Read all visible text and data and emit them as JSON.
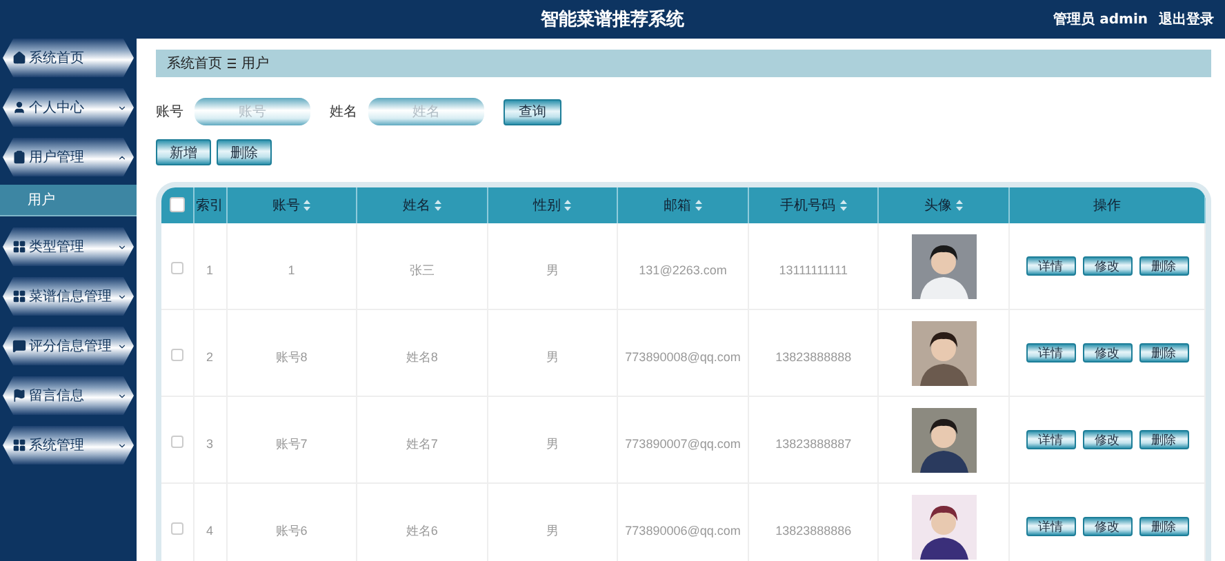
{
  "header": {
    "title": "智能菜谱推荐系统",
    "user": "管理员 admin",
    "logout": "退出登录"
  },
  "sidebar": {
    "items": [
      {
        "label": "系统首页",
        "kind": "link"
      },
      {
        "label": "个人中心",
        "kind": "menu",
        "expanded": false
      },
      {
        "label": "用户管理",
        "kind": "menu",
        "expanded": true,
        "children": [
          {
            "label": "用户",
            "selected": true
          }
        ]
      },
      {
        "label": "类型管理",
        "kind": "menu",
        "expanded": false
      },
      {
        "label": "菜谱信息管理",
        "kind": "menu",
        "expanded": false
      },
      {
        "label": "评分信息管理",
        "kind": "menu",
        "expanded": false
      },
      {
        "label": "留言信息",
        "kind": "menu",
        "expanded": false
      },
      {
        "label": "系统管理",
        "kind": "menu",
        "expanded": false
      }
    ]
  },
  "breadcrumb": [
    "系统首页",
    "用户"
  ],
  "search": {
    "fields": [
      {
        "label": "账号",
        "placeholder": "账号"
      },
      {
        "label": "姓名",
        "placeholder": "姓名"
      }
    ],
    "button": "查询"
  },
  "actions": [
    "新增",
    "删除"
  ],
  "table": {
    "select_all": {
      "checked": false
    },
    "columns": [
      {
        "label": "索引",
        "sortable": false
      },
      {
        "label": "账号",
        "sortable": true
      },
      {
        "label": "姓名",
        "sortable": true
      },
      {
        "label": "性别",
        "sortable": true
      },
      {
        "label": "邮箱",
        "sortable": true
      },
      {
        "label": "手机号码",
        "sortable": true
      },
      {
        "label": "头像",
        "sortable": true
      },
      {
        "label": "操作",
        "sortable": false
      }
    ],
    "rows": [
      {
        "checked": false,
        "cells": [
          "1",
          "1",
          "张三",
          "男",
          "131@2263.com",
          "13111111111"
        ],
        "avatar": {
          "kind": "picture"
        },
        "actions": [
          "详情",
          "修改",
          "删除"
        ]
      },
      {
        "checked": false,
        "cells": [
          "2",
          "账号8",
          "姓名8",
          "男",
          "773890008@qq.com",
          "13823888888"
        ],
        "avatar": {
          "kind": "picture"
        },
        "actions": [
          "详情",
          "修改",
          "删除"
        ]
      },
      {
        "checked": false,
        "cells": [
          "3",
          "账号7",
          "姓名7",
          "男",
          "773890007@qq.com",
          "13823888887"
        ],
        "avatar": {
          "kind": "picture"
        },
        "actions": [
          "详情",
          "修改",
          "删除"
        ]
      },
      {
        "checked": false,
        "cells": [
          "4",
          "账号6",
          "姓名6",
          "男",
          "773890006@qq.com",
          "13823888886"
        ],
        "avatar": {
          "kind": "picture"
        },
        "actions": [
          "详情",
          "修改",
          "删除"
        ]
      }
    ]
  }
}
